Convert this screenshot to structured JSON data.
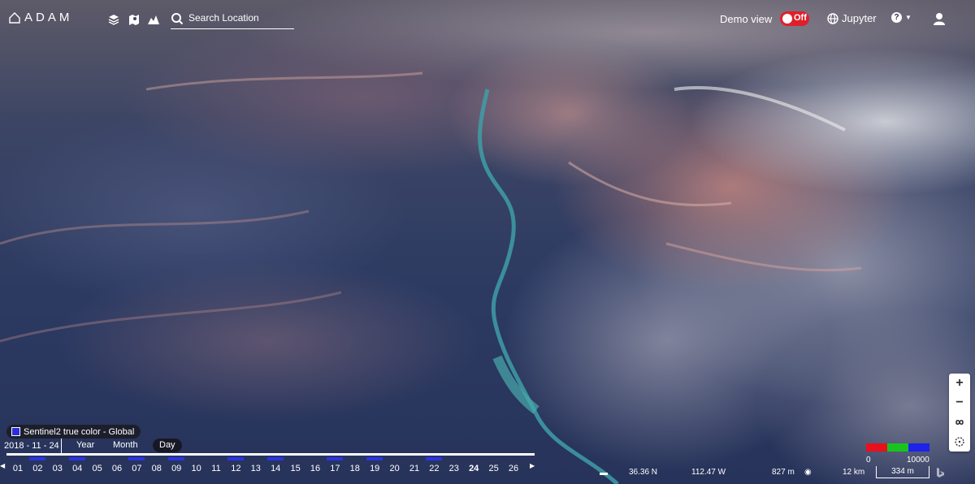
{
  "app": {
    "logo_text": "ADAM",
    "search_placeholder": "Search Location"
  },
  "header": {
    "demo_view_label": "Demo view",
    "demo_view_toggle": "Off",
    "jupyter_label": "Jupyter"
  },
  "layer": {
    "name": "Sentinel2 true color - Global",
    "swatch_color": "#2b2fd9"
  },
  "timeline": {
    "date": "2018 - 11 - 24",
    "modes": [
      "Year",
      "Month",
      "Day"
    ],
    "active_mode": "Day",
    "days": [
      {
        "label": "01",
        "data": false
      },
      {
        "label": "02",
        "data": true
      },
      {
        "label": "03",
        "data": false
      },
      {
        "label": "04",
        "data": true
      },
      {
        "label": "05",
        "data": false
      },
      {
        "label": "06",
        "data": false
      },
      {
        "label": "07",
        "data": true
      },
      {
        "label": "08",
        "data": false
      },
      {
        "label": "09",
        "data": true
      },
      {
        "label": "10",
        "data": false
      },
      {
        "label": "11",
        "data": false
      },
      {
        "label": "12",
        "data": true
      },
      {
        "label": "13",
        "data": false
      },
      {
        "label": "14",
        "data": true
      },
      {
        "label": "15",
        "data": false
      },
      {
        "label": "16",
        "data": false
      },
      {
        "label": "17",
        "data": true
      },
      {
        "label": "18",
        "data": false
      },
      {
        "label": "19",
        "data": true
      },
      {
        "label": "20",
        "data": false
      },
      {
        "label": "21",
        "data": false
      },
      {
        "label": "22",
        "data": true
      },
      {
        "label": "23",
        "data": false
      },
      {
        "label": "24",
        "data": false
      },
      {
        "label": "25",
        "data": false
      },
      {
        "label": "26",
        "data": false
      }
    ],
    "selected_day": "24"
  },
  "status": {
    "latitude": "36.36 N",
    "longitude": "112.47 W",
    "elevation": "827 m",
    "distance": "12 km",
    "scale": "334 m"
  },
  "legend": {
    "min": "0",
    "max": "10000",
    "colors": [
      "#e8101c",
      "#19c41f",
      "#1d23e8"
    ]
  },
  "zoom": {
    "in": "+",
    "out": "−"
  }
}
